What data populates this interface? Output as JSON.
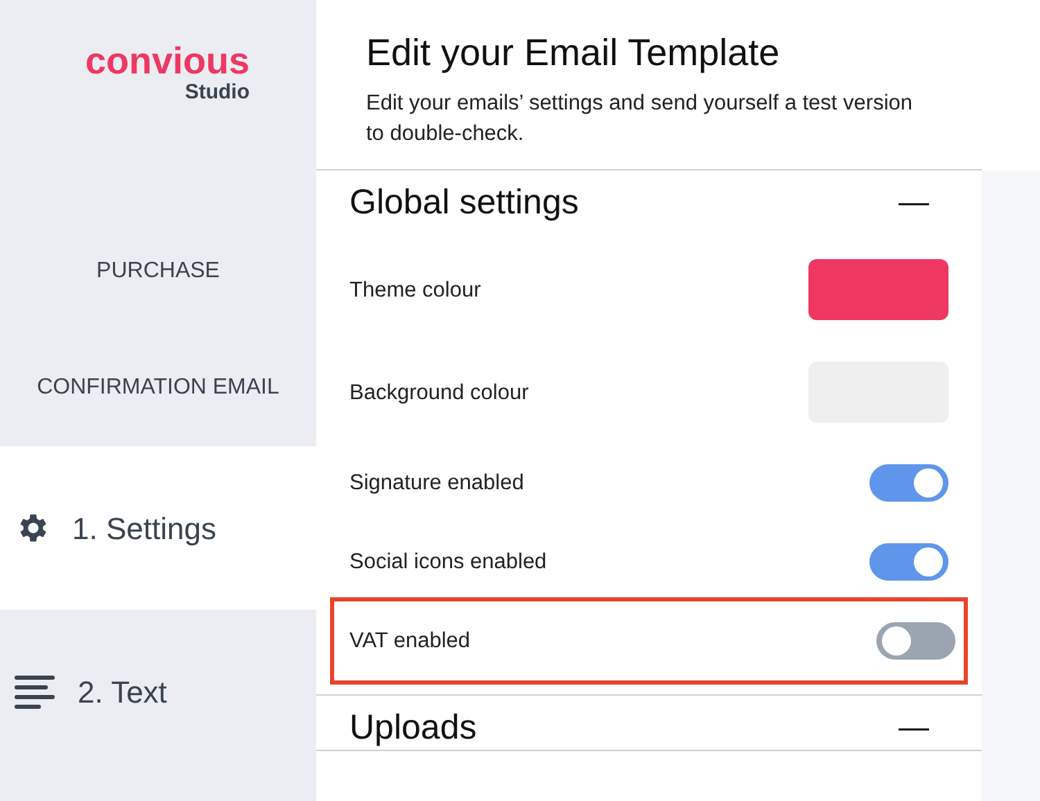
{
  "sidebar": {
    "logo": {
      "brand": "convious",
      "product": "Studio"
    },
    "template_name": "PURCHASE CONFIRMATION EMAIL",
    "steps": [
      {
        "label": "1. Settings",
        "kind": "gear",
        "selected": true
      },
      {
        "label": "2. Text",
        "kind": "lines",
        "selected": false
      }
    ]
  },
  "header": {
    "title": "Edit your Email Template",
    "subtitle": "Edit your emails’ settings and send yourself a test version to double-check."
  },
  "sections": [
    {
      "title": "Global settings",
      "toggle": "—",
      "expanded": true,
      "settings": [
        {
          "label": "Theme colour",
          "kind": "swatch",
          "color": "#ee3862",
          "highlighted": false
        },
        {
          "label": "Background colour",
          "kind": "swatch",
          "color": "#efefef",
          "highlighted": false
        },
        {
          "label": "Signature enabled",
          "kind": "switch",
          "on": true,
          "highlighted": false
        },
        {
          "label": "Social icons enabled",
          "kind": "switch",
          "on": true,
          "highlighted": false
        },
        {
          "label": "VAT enabled",
          "kind": "switch",
          "on": false,
          "highlighted": true
        }
      ]
    },
    {
      "title": "Uploads",
      "toggle": "—",
      "expanded": true
    }
  ]
}
